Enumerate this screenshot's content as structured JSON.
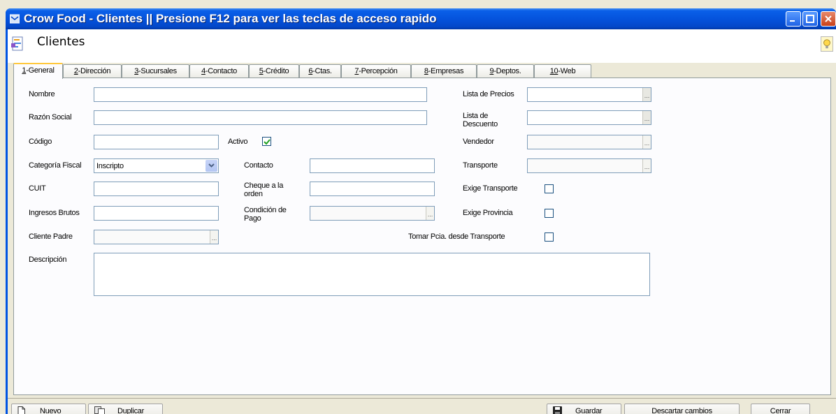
{
  "window": {
    "title": "Crow Food - Clientes || Presione F12 para ver las teclas de acceso rapido"
  },
  "header": {
    "title": "Clientes"
  },
  "tabs": [
    {
      "key": "1",
      "label": "-General",
      "active": true
    },
    {
      "key": "2",
      "label": "-Dirección"
    },
    {
      "key": "3",
      "label": "-Sucursales"
    },
    {
      "key": "4",
      "label": "-Contacto"
    },
    {
      "key": "5",
      "label": "-Crédito"
    },
    {
      "key": "6",
      "label": "-Ctas."
    },
    {
      "key": "7",
      "label": "-Percepción"
    },
    {
      "key": "8",
      "label": "-Empresas"
    },
    {
      "key": "9",
      "label": "-Deptos."
    },
    {
      "key": "10",
      "label": "-Web"
    }
  ],
  "form": {
    "nombre_label": "Nombre",
    "nombre_value": "",
    "razon_social_label": "Razón Social",
    "razon_social_value": "",
    "codigo_label": "Código",
    "codigo_value": "",
    "activo_label": "Activo",
    "activo_checked": true,
    "categoria_fiscal_label": "Categoría Fiscal",
    "categoria_fiscal_value": "Inscripto",
    "cuit_label": "CUIT",
    "cuit_value": "",
    "ingresos_brutos_label": "Ingresos Brutos",
    "ingresos_brutos_value": "",
    "cliente_padre_label": "Cliente Padre",
    "cliente_padre_value": "",
    "descripcion_label": "Descripción",
    "descripcion_value": "",
    "contacto_label": "Contacto",
    "contacto_value": "",
    "cheque_label_1": "Cheque a la",
    "cheque_label_2": "orden",
    "cheque_value": "",
    "condicion_label_1": "Condición de",
    "condicion_label_2": "Pago",
    "condicion_value": "",
    "lista_precios_label": "Lista de Precios",
    "lista_precios_value": "",
    "lista_descuento_label_1": "Lista de",
    "lista_descuento_label_2": "Descuento",
    "lista_descuento_value": "",
    "vendedor_label": "Vendedor",
    "vendedor_value": "",
    "transporte_label": "Transporte",
    "transporte_value": "",
    "exige_transporte_label": "Exige Transporte",
    "exige_transporte_checked": false,
    "exige_provincia_label": "Exige Provincia",
    "exige_provincia_checked": false,
    "tomar_pcia_label": "Tomar Pcia. desde Transporte",
    "tomar_pcia_checked": false,
    "ellipsis": "..."
  },
  "buttons": {
    "nuevo_first": "N",
    "nuevo_rest": "uevo",
    "duplicar_first": "D",
    "duplicar_rest": "uplicar",
    "guardar_first": "G",
    "guardar_rest": "uardar",
    "descartar_first": "D",
    "descartar_rest": "escartar cambios",
    "cerrar_first": "C",
    "cerrar_rest": "errar"
  },
  "colors": {
    "titlebar": "#0553dd",
    "tab_highlight": "#ffc83c",
    "input_border": "#7f9db9",
    "check_mark": "#21a121"
  }
}
